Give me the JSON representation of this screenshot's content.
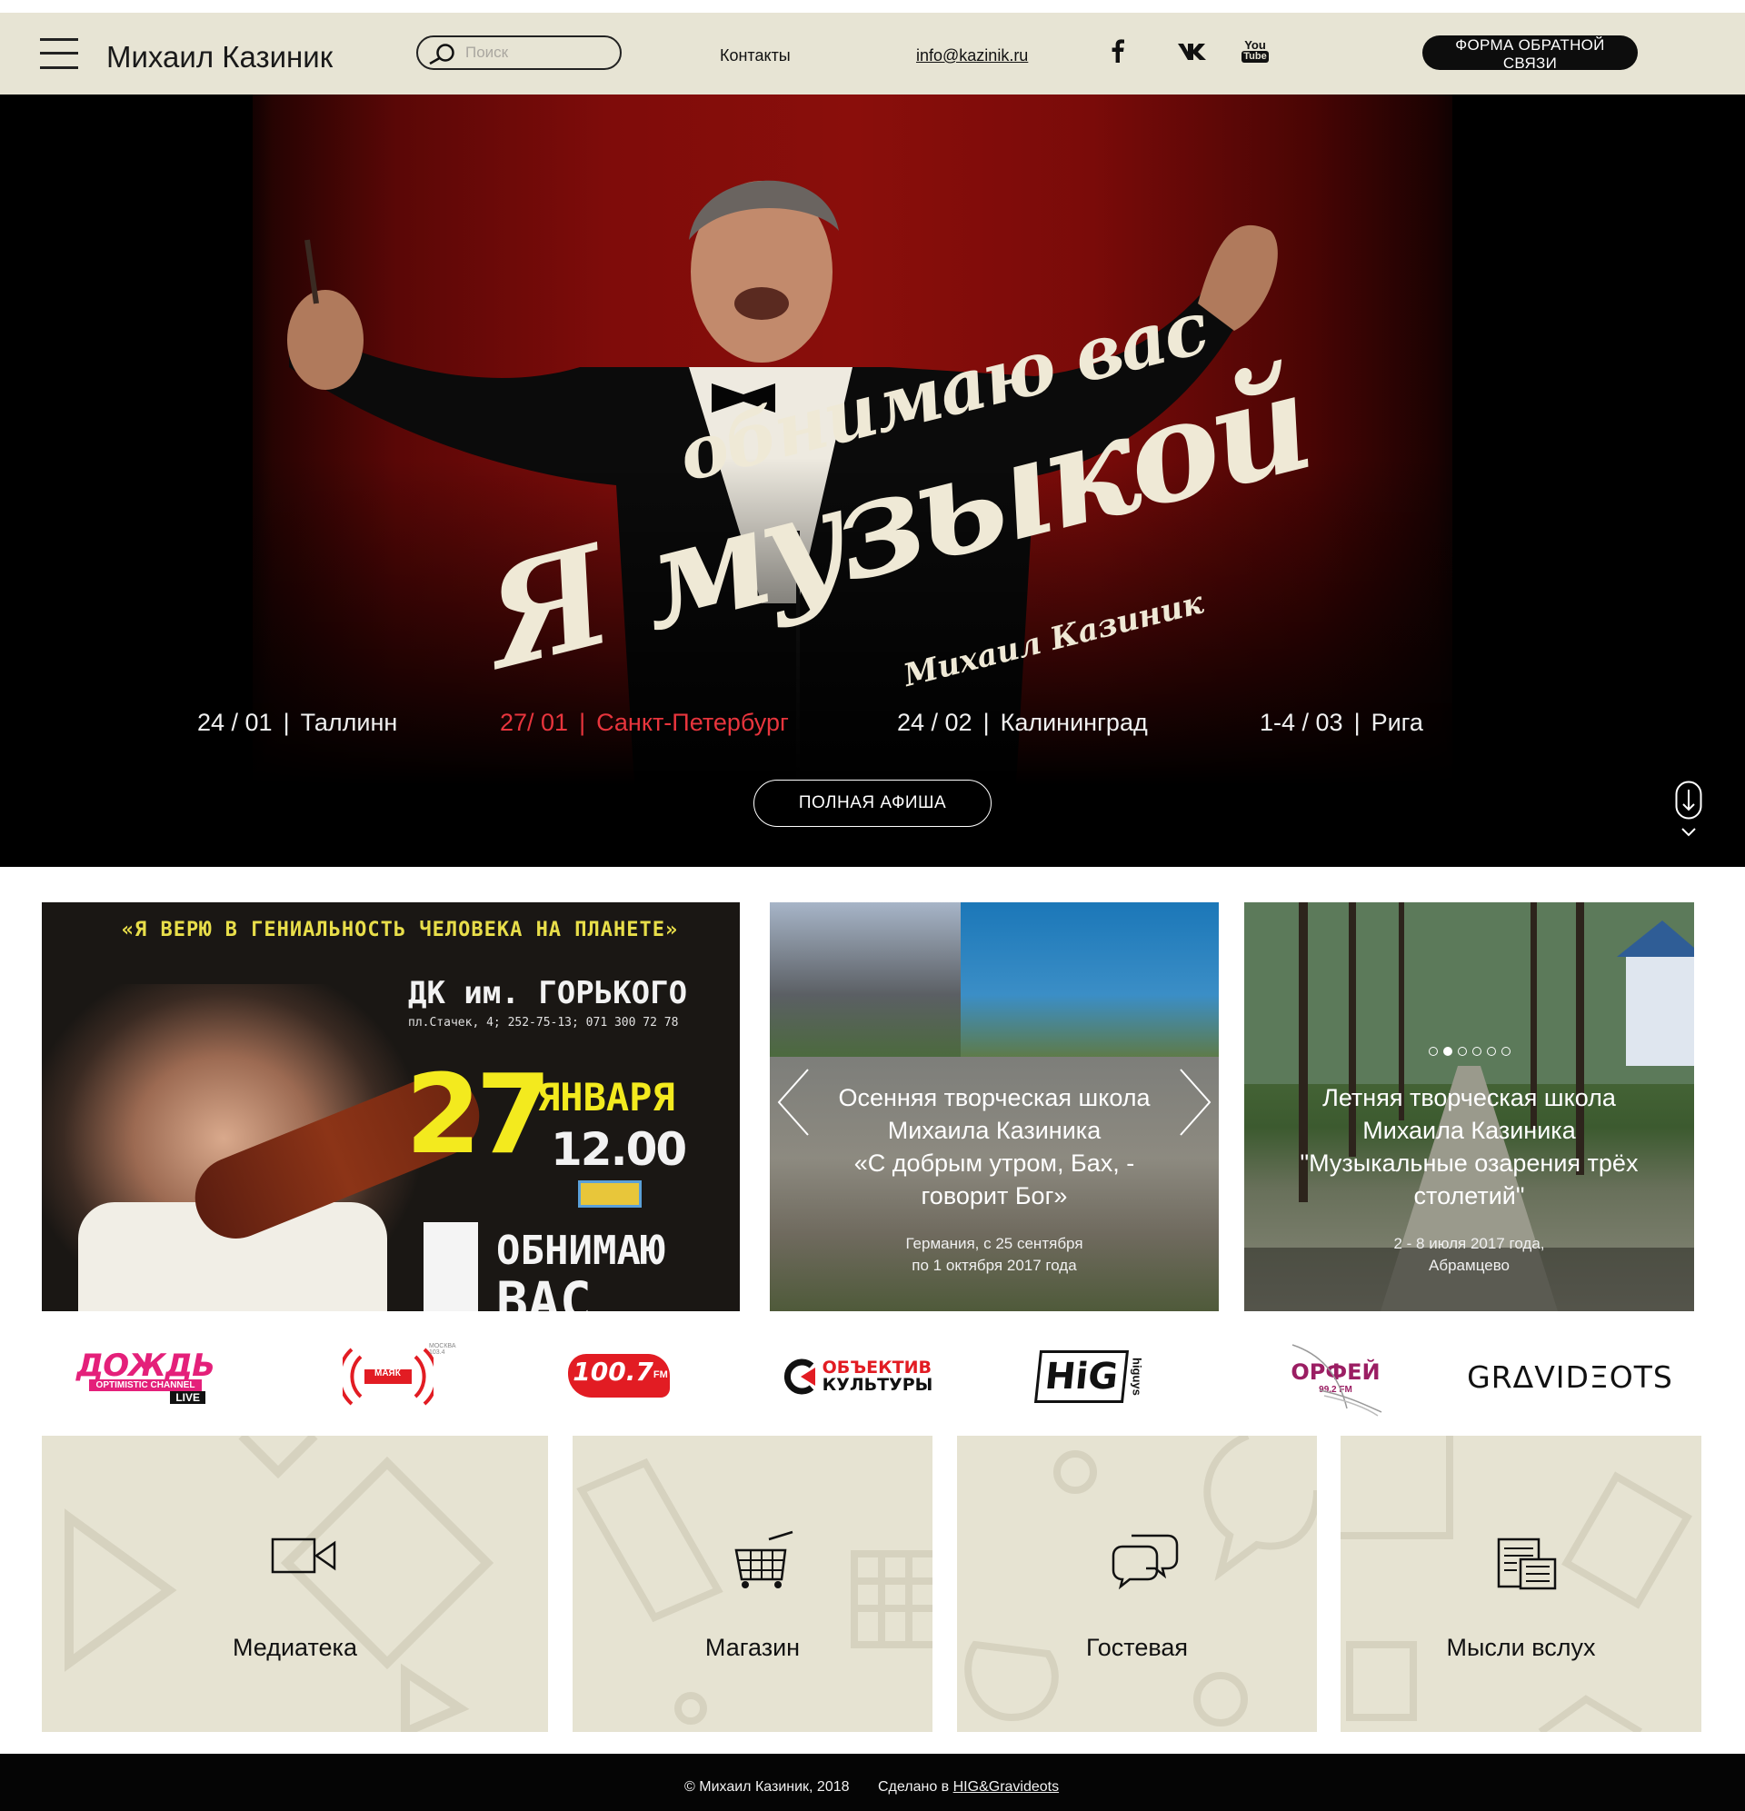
{
  "header": {
    "site_title": "Михаил Казиник",
    "search_placeholder": "Поиск",
    "contacts_label": "Контакты",
    "email": "info@kazinik.ru",
    "social": [
      "facebook-icon",
      "vk-icon",
      "youtube-icon"
    ],
    "youtube_text_1": "You",
    "youtube_text_2": "Tube",
    "feedback_label": "ФОРМА ОБРАТНОЙ СВЯЗИ",
    "background_color": "#e7e4d4"
  },
  "hero": {
    "script_line_1": "обнимаю вас",
    "script_line_2": "Я музыкой",
    "script_signature": "Михаил Казиник",
    "events": [
      {
        "date": "24 / 01",
        "city": "Таллинн",
        "active": false
      },
      {
        "date": "27/ 01",
        "city": "Санкт-Петербург",
        "active": true
      },
      {
        "date": "24 / 02",
        "city": "Калининград",
        "active": false
      },
      {
        "date": "1-4 / 03",
        "city": "Рига",
        "active": false
      }
    ],
    "event_separator": "|",
    "afisha_label": "ПОЛНАЯ АФИША",
    "accent_color": "#e8353d"
  },
  "cards": {
    "poster": {
      "top_line": "«Я ВЕРЮ В ГЕНИАЛЬНОСТЬ ЧЕЛОВЕКА НА ПЛАНЕТЕ»",
      "venue": "ДК им. ГОРЬКОГО",
      "address": "пл.Стачек, 4; 252-75-13; 071 300 72 78",
      "day": "27",
      "month": "ЯНВАРЯ",
      "time": "12.00",
      "bottom_line_1": "ОБНИМАЮ",
      "bottom_line_2": "ВАС"
    },
    "autumn_school": {
      "title_lines": [
        "Осенняя творческая школа",
        "Михаила Казиника",
        "«С добрым утром, Бах, -",
        "говорит Бог»"
      ],
      "sub_lines": [
        "Германия, с 25 сентября",
        "по 1 октября 2017 года"
      ]
    },
    "summer_school": {
      "title_lines": [
        "Летняя творческая школа",
        "Михаила Казиника",
        "\"Музыкальные озарения трёх",
        "столетий\""
      ],
      "sub_lines": [
        "2 - 8 июля 2017 года,",
        "Абрамцево"
      ],
      "slide_count": 6,
      "active_slide": 2
    }
  },
  "partners": [
    {
      "name": "ДОЖДЬ",
      "tagline": "OPTIMISTIC CHANNEL",
      "badge": "LIVE"
    },
    {
      "name": "МАЯК",
      "tagline": "МОСКВА 103.4"
    },
    {
      "name": "100.7",
      "tagline": "FM"
    },
    {
      "name_1": "ОБЪЕКТИВ",
      "name_2": "КУЛЬТУРЫ"
    },
    {
      "name": "HiG",
      "tagline": "higuys"
    },
    {
      "name": "ОРФЕЙ",
      "tagline": "99.2 FM"
    },
    {
      "name": "GRΔVIDΞOTS"
    }
  ],
  "tiles": [
    {
      "label": "Медиатека",
      "icon": "video-camera-icon"
    },
    {
      "label": "Магазин",
      "icon": "shopping-cart-icon"
    },
    {
      "label": "Гостевая",
      "icon": "chat-bubbles-icon"
    },
    {
      "label": "Мысли вслух",
      "icon": "newspaper-icon"
    }
  ],
  "footer": {
    "copyright": "© Михаил Казиник, 2018",
    "made_prefix": "Сделано в",
    "made_link": "HIG&Gravideots"
  }
}
